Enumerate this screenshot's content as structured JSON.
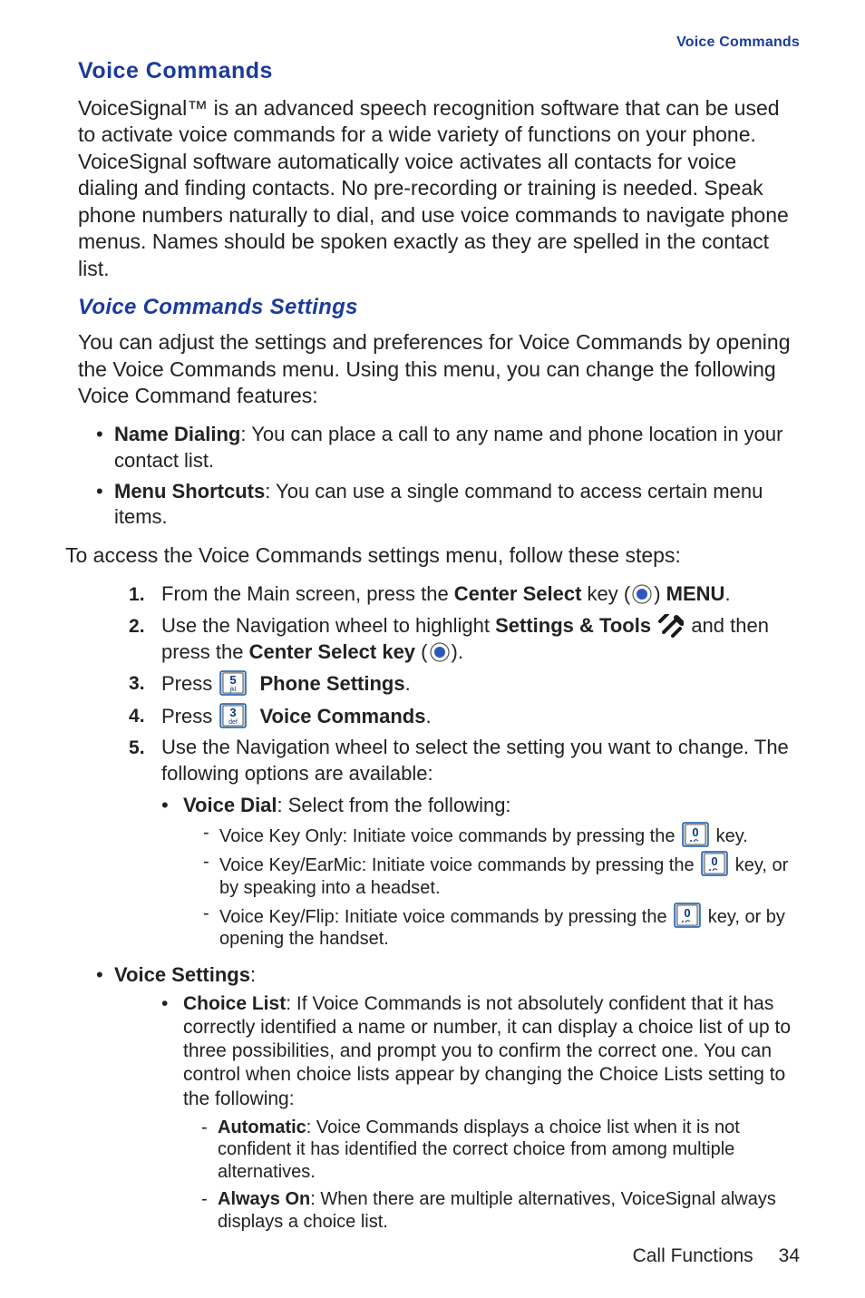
{
  "header": {
    "running_head": "Voice Commands"
  },
  "section": {
    "title": "Voice Commands",
    "intro": "VoiceSignal™ is an advanced speech recognition software that can be used to activate voice commands for a wide variety of functions on your phone. VoiceSignal software automatically voice activates all contacts for voice dialing and finding contacts. No pre-recording or training is needed. Speak phone numbers naturally to dial, and use voice commands to navigate phone menus. Names should be spoken exactly as they are spelled in the contact list."
  },
  "settings": {
    "title": "Voice Commands Settings",
    "intro": "You can adjust the settings and preferences for Voice Commands by opening the Voice Commands menu. Using this menu, you can change the following Voice Command features:",
    "features": [
      {
        "name": "Name Dialing",
        "desc": ": You can place a call to any name and phone location in your contact list."
      },
      {
        "name": "Menu Shortcuts",
        "desc": ": You can use a single command to access certain menu items."
      }
    ],
    "access_text": "To access the Voice Commands settings menu, follow these steps:",
    "steps": {
      "s1": {
        "pre": "From the Main screen, press the ",
        "key_bold": "Center Select",
        "key_tail": " key (",
        "close": ") ",
        "menu_bold": "MENU",
        "end": "."
      },
      "s2": {
        "pre": "Use the Navigation wheel to highlight ",
        "st_bold": "Settings & Tools",
        "mid": " and then press the ",
        "cs_bold": "Center Select key",
        "tail": " (",
        "close": ")."
      },
      "s3": {
        "pre": "Press ",
        "label_bold": "Phone Settings",
        "end": "."
      },
      "s4": {
        "pre": "Press ",
        "label_bold": "Voice Commands",
        "end": "."
      },
      "s5": {
        "text": "Use the Navigation wheel to select the setting you want to change. The following options are available:"
      }
    },
    "voice_dial_label": "Voice Dial",
    "voice_dial_tail": ": Select from the following:",
    "voice_dial_items": [
      {
        "pre": "Voice Key Only: Initiate voice commands by pressing the ",
        "tail": " key."
      },
      {
        "pre": "Voice Key/EarMic: Initiate voice commands by pressing the ",
        "tail": " key, or by speaking into a headset."
      },
      {
        "pre": "Voice Key/Flip: Initiate voice commands by pressing the ",
        "tail": " key, or by opening the handset."
      }
    ],
    "voice_settings_label": "Voice Settings",
    "choice_list": {
      "name": "Choice List",
      "desc": ": If Voice Commands is not absolutely confident that it has correctly identified a name or number, it can display a choice list of up to three possibilities, and prompt you to confirm the correct one. You can control when choice lists appear by changing the Choice Lists setting to the following:",
      "items": [
        {
          "name": "Automatic",
          "desc": ": Voice Commands displays a choice list when it is not confident it has identified the correct choice from among multiple alternatives."
        },
        {
          "name": "Always On",
          "desc": ": When there are multiple alternatives, VoiceSignal always displays a choice list."
        }
      ]
    }
  },
  "key_icons": {
    "key5_label": "5",
    "key5_sub": "jkl",
    "key3_label": "3",
    "key3_sub": "def",
    "key0_label": "0"
  },
  "footer": {
    "chapter": "Call Functions",
    "page": "34"
  }
}
